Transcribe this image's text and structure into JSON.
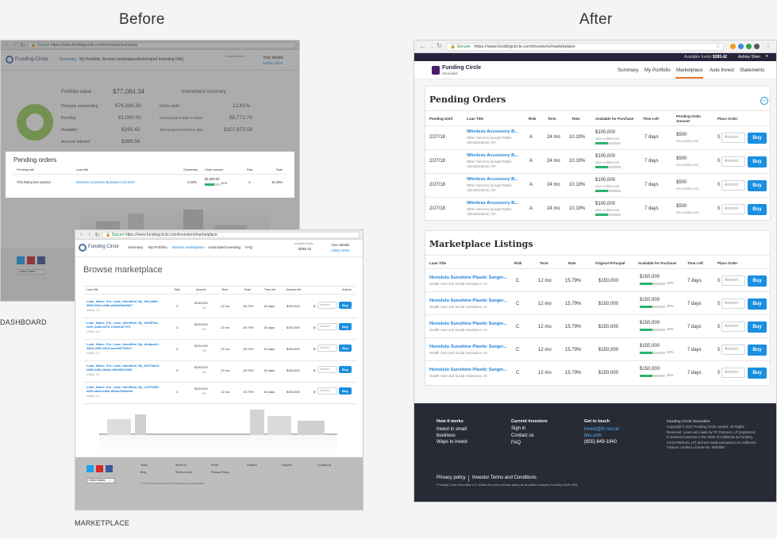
{
  "headings": {
    "before": "Before",
    "after": "After"
  },
  "captions": {
    "dashboard": "DASHBOARD",
    "marketplace": "MARKETPLACE"
  },
  "dashboard": {
    "url": "https://www.fundingcircle.com/investors/summary",
    "logo": "Funding Circle",
    "nav": [
      "Summary",
      "My Portfolio",
      "Browse marketplace",
      "Automated Investing",
      "FAQ"
    ],
    "funds_label": "Available funds",
    "your_details": "Your details",
    "user": "Ashley Shen",
    "portfolio_value_label": "Portfolio value",
    "portfolio_value": "$77,084.34",
    "portfolio_rows": [
      {
        "label": "Principal outstanding",
        "value": "$76,284.30"
      },
      {
        "label": "Pending",
        "value": "$1,000.00"
      },
      {
        "label": "Available",
        "value": "$285.42"
      },
      {
        "label": "Accrued interest",
        "value": "$389.56"
      }
    ],
    "investment_summary_label": "Investment summary",
    "investment_rows": [
      {
        "label": "Gross yield",
        "value": "12.81%"
      },
      {
        "label": "Interest paid to date on loans",
        "value": "$5,772.79"
      },
      {
        "label": "Total amount invested to date",
        "value": "$107,670.58"
      }
    ],
    "pending_title": "Pending orders",
    "pending_headers": [
      "Pending until",
      "Loan title",
      "Ownership",
      "Order amount",
      "Risk",
      "Rate"
    ],
    "pending_row": {
      "until": "This listing has expired",
      "title": "Wireless Accessory Business 2.23.2017",
      "ownership": "0.33%",
      "amount": "$1,000.00",
      "pct": "61%",
      "risk": "A",
      "rate": "10.19%"
    },
    "pending_fill": 0.61,
    "country": "United States"
  },
  "marketplace": {
    "url": "https://www.fundingcircle.com/investors/marketplace",
    "logo": "Funding Circle",
    "nav": [
      "Summary",
      "My Portfolio",
      "Browse marketplace",
      "Automated Investing",
      "FAQ"
    ],
    "funds_label": "Available funds",
    "funds": "$285.42",
    "your_details": "Your details",
    "user": "Ashley Shen",
    "title": "Browse marketplace",
    "headers": [
      "Loan title",
      "Risk",
      "Amount",
      "Term",
      "Rate",
      "Time left",
      "Amount left",
      "Actions"
    ],
    "rows": [
      {
        "title": "Loan_Name_For_Loan_Identified_By_56c209fe-3893-4601-a39b-a5b2d6bd9df7",
        "loc": "Utilities, CA",
        "risk": "C",
        "amount": "$150,000",
        "pct": "0%",
        "term": "12 mo",
        "rate": "15.79%",
        "time": "15 days",
        "left": "$150,000"
      },
      {
        "title": "Loan_Name_For_Loan_Identified_By_b635f7ac-e897-4d5d-bf73-7c33f1467f73",
        "loc": "Utilities, CA",
        "risk": "C",
        "amount": "$150,000",
        "pct": "0%",
        "term": "12 mo",
        "rate": "15.79%",
        "time": "15 days",
        "left": "$150,000"
      },
      {
        "title": "Loan_Name_For_Loan_Identified_By_db4aea11-48cb-4300-92e5-aca4407529e7",
        "loc": "Utilities, CA",
        "risk": "C",
        "amount": "$150,000",
        "pct": "0%",
        "term": "12 mo",
        "rate": "15.79%",
        "time": "15 days",
        "left": "$150,000"
      },
      {
        "title": "Loan_Name_For_Loan_Identified_By_82376de3-e883-4d01-9ddb-e69e951446f8",
        "loc": "Utilities, CA",
        "risk": "C",
        "amount": "$150,000",
        "pct": "0%",
        "term": "12 mo",
        "rate": "15.79%",
        "time": "15 days",
        "left": "$150,000"
      },
      {
        "title": "Loan_Name_For_Loan_Identified_By_c1976455-d60f-4d6d-ad94-d5dcc5994d2d",
        "loc": "Utilities, CA",
        "risk": "C",
        "amount": "$150,000",
        "pct": "0%",
        "term": "12 mo",
        "rate": "15.79%",
        "time": "15 days",
        "left": "$150,000"
      }
    ],
    "amount_placeholder": "Amount",
    "buy_label": "Buy",
    "footer_cols": [
      [
        "Team",
        "Blog"
      ],
      [
        "About us",
        "Terms of Use"
      ],
      [
        "Press",
        "Privacy Policy"
      ],
      [
        "Careers"
      ],
      [
        "Support"
      ],
      [
        "Contact us"
      ]
    ],
    "country": "United States",
    "copyright": "© 2017 Funding Circle Limited. All Rights Reserved. FINRA/SIPC"
  },
  "after": {
    "url": "https://www.fundingcircle.com/investors/marketplace",
    "url_secure": "Secure",
    "funds_label": "Available funds:",
    "funds": "$285.42",
    "user": "Ashley Shen",
    "logo": "Funding Circle",
    "logo_sub": "Securities",
    "nav": [
      "Summary",
      "My Portfolio",
      "Marketplace",
      "Auto Invest",
      "Statements"
    ],
    "active_nav": "Marketplace",
    "pending": {
      "title": "Pending Orders",
      "headers": [
        "Pending Until",
        "Loan Title",
        "Risk",
        "Term",
        "Rate",
        "Available for Purchase",
        "Time Left",
        "Pending Order Amount",
        "Place Order"
      ],
      "rows": [
        {
          "until": "2/27/18",
          "title": "Wireless Accessory B...",
          "sub": "Other Services (except Public Administration), NY",
          "risk": "A",
          "term": "24 mo",
          "rate": "10.19%",
          "avail": "$100,000",
          "avail_sub": "49% of $500,000",
          "fill": 0.49,
          "time": "7 days",
          "order": "$500",
          "order_sub": "5% of $500,000"
        },
        {
          "until": "2/27/18",
          "title": "Wireless Accessory B...",
          "sub": "Other Services (except Public Administration), NY",
          "risk": "A",
          "term": "24 mo",
          "rate": "10.19%",
          "avail": "$100,000",
          "avail_sub": "49% of $500,000",
          "fill": 0.49,
          "time": "7 days",
          "order": "$500",
          "order_sub": "5% of $500,000"
        },
        {
          "until": "2/27/18",
          "title": "Wireless Accessory B...",
          "sub": "Other Services (except Public Administration), NY",
          "risk": "A",
          "term": "24 mo",
          "rate": "10.19%",
          "avail": "$100,000",
          "avail_sub": "49% of $500,000",
          "fill": 0.49,
          "time": "7 days",
          "order": "$500",
          "order_sub": "5% of $500,000"
        },
        {
          "until": "2/27/18",
          "title": "Wireless Accessory B...",
          "sub": "Other Services (except Public Administration), NY",
          "risk": "A",
          "term": "24 mo",
          "rate": "10.19%",
          "avail": "$100,000",
          "avail_sub": "49% of $500,000",
          "fill": 0.49,
          "time": "7 days",
          "order": "$500",
          "order_sub": "5% of $500,000"
        }
      ]
    },
    "listings": {
      "title": "Marketplace Listings",
      "headers": [
        "Loan Title",
        "Risk",
        "Term",
        "Rate",
        "Original Principal",
        "Available for Purchase",
        "Time Left",
        "Place Order"
      ],
      "rows": [
        {
          "title": "Honolulu Sunshine Plastic Surger...",
          "sub": "Health Care and Social Assistance, HI",
          "risk": "C",
          "term": "12 mo",
          "rate": "15.79%",
          "principal": "$150,000",
          "avail": "$150,000",
          "pct": "49%",
          "fill": 0.49,
          "time": "7 days"
        },
        {
          "title": "Honolulu Sunshine Plastic Surger...",
          "sub": "Health Care and Social Assistance, HI",
          "risk": "C",
          "term": "12 mo",
          "rate": "15.79%",
          "principal": "$150,000",
          "avail": "$150,000",
          "pct": "49%",
          "fill": 0.49,
          "time": "7 days"
        },
        {
          "title": "Honolulu Sunshine Plastic Surger...",
          "sub": "Health Care and Social Assistance, HI",
          "risk": "C",
          "term": "12 mo",
          "rate": "15.79%",
          "principal": "$150,000",
          "avail": "$150,000",
          "pct": "49%",
          "fill": 0.49,
          "time": "7 days"
        },
        {
          "title": "Honolulu Sunshine Plastic Surger...",
          "sub": "Health Care and Social Assistance, HI",
          "risk": "C",
          "term": "12 mo",
          "rate": "15.79%",
          "principal": "$150,000",
          "avail": "$150,000",
          "pct": "49%",
          "fill": 0.49,
          "time": "7 days"
        },
        {
          "title": "Honolulu Sunshine Plastic Surger...",
          "sub": "Health Care and Social Assistance, HI",
          "risk": "C",
          "term": "12 mo",
          "rate": "15.79%",
          "principal": "$150,000",
          "avail": "$150,000",
          "pct": "49%",
          "fill": 0.49,
          "time": "7 days"
        }
      ]
    },
    "amount_placeholder": "Amount",
    "buy_label": "Buy",
    "dollar": "$",
    "footer": {
      "col1_title": "How it works",
      "col1": [
        "Invest in small business",
        "Ways to invest"
      ],
      "col2_title": "Current investors",
      "col2": [
        "Sign in",
        "Contact us",
        "FAQ"
      ],
      "col3_title": "Get in touch",
      "col3_email": "invest@fc-securities.com",
      "col3_phone": "(855) 849-1940",
      "legal_title": "Funding Circle Securities",
      "legal": "Copyright © 2017 Funding Circle Limited. All Rights Reserved. Loans are made by FC Partners, LP (registered to transact business in the State of California as Funding Circle Partners, LP) and are made pursuant to its California Finance Lenders License No. 6054657",
      "privacy": "Privacy policy",
      "terms": "Investor Terms and Conditions",
      "disclaimer": "*Funding Circle Securities LLC shares the same privacy policy as its parent company Funding Circle USA."
    },
    "colors": {
      "accent": "#1a8fe0",
      "nav_bar": "#25223a",
      "footer": "#262b36",
      "progress": "#2db36a",
      "active_underline": "#e8772e",
      "logo": "#4b1d6b"
    }
  }
}
